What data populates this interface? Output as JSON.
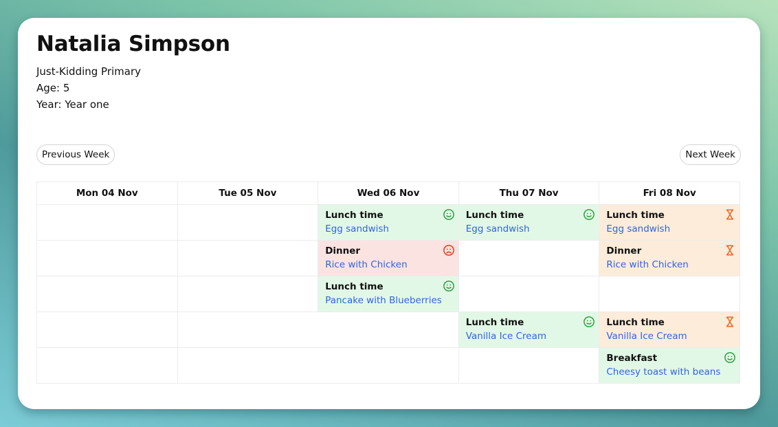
{
  "student": {
    "name": "Natalia Simpson",
    "school": "Just-Kidding Primary",
    "age_label": "Age: 5",
    "year_label": "Year: Year one"
  },
  "nav": {
    "previous_label": "Previous Week",
    "next_label": "Next Week"
  },
  "colors": {
    "eaten_bg": "#e2f8e6",
    "not_eaten_bg": "#fbe3e2",
    "pending_bg": "#fcecd9",
    "happy_icon": "#2f9e44",
    "sad_icon": "#e03e1a",
    "pending_icon": "#e8692a",
    "meal_link": "#2f64e0"
  },
  "days": [
    "Mon 04 Nov",
    "Tue 05 Nov",
    "Wed 06 Nov",
    "Thu 07 Nov",
    "Fri 08 Nov"
  ],
  "meals": {
    "wed_r1": {
      "type": "Lunch time",
      "dish": "Egg sandwish",
      "status": "happy-face-icon"
    },
    "thu_r1": {
      "type": "Lunch time",
      "dish": "Egg sandwish",
      "status": "happy-face-icon"
    },
    "fri_r1": {
      "type": "Lunch time",
      "dish": "Egg sandwish",
      "status": "hourglass-icon"
    },
    "wed_r2": {
      "type": "Dinner",
      "dish": "Rice with Chicken",
      "status": "sad-face-icon"
    },
    "fri_r2": {
      "type": "Dinner",
      "dish": "Rice with Chicken",
      "status": "hourglass-icon"
    },
    "wed_r3": {
      "type": "Lunch time",
      "dish": "Pancake with Blueberries",
      "status": "happy-face-icon"
    },
    "thu_r4": {
      "type": "Lunch time",
      "dish": "Vanilla Ice Cream",
      "status": "happy-face-icon"
    },
    "fri_r4": {
      "type": "Lunch time",
      "dish": "Vanilla Ice Cream",
      "status": "hourglass-icon"
    },
    "fri_r5": {
      "type": "Breakfast",
      "dish": "Cheesy toast with beans",
      "status": "happy-face-icon"
    }
  }
}
